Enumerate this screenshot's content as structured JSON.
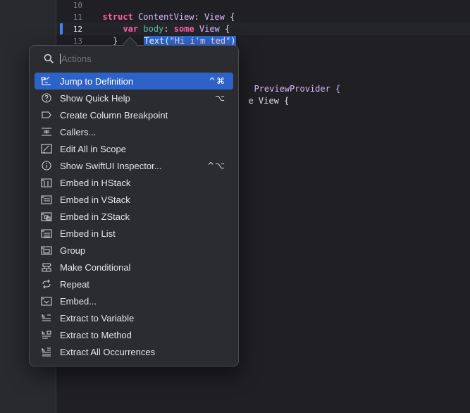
{
  "editor": {
    "lines": [
      {
        "num": "10",
        "text": "struct ContentView: View {"
      },
      {
        "num": "11",
        "text": "var body: some View {"
      },
      {
        "num": "12",
        "text": "Text(\"Hi i'm ted\")"
      },
      {
        "num": "13",
        "text": "}"
      }
    ],
    "partial_line_1": "PreviewProvider {",
    "partial_line_2": "e View {"
  },
  "popover": {
    "search_placeholder": "Actions",
    "items": [
      {
        "label": "Jump to Definition",
        "shortcut": "^⌘",
        "icon": "jump-icon",
        "selected": true
      },
      {
        "label": "Show Quick Help",
        "shortcut": "⌥",
        "icon": "question-icon"
      },
      {
        "label": "Create Column Breakpoint",
        "shortcut": "",
        "icon": "breakpoint-icon"
      },
      {
        "label": "Callers...",
        "shortcut": "",
        "icon": "callers-icon"
      },
      {
        "label": "Edit All in Scope",
        "shortcut": "",
        "icon": "edit-scope-icon"
      },
      {
        "label": "Show SwiftUI Inspector...",
        "shortcut": "^⌥",
        "icon": "info-icon"
      },
      {
        "label": "Embed in HStack",
        "shortcut": "",
        "icon": "hstack-icon"
      },
      {
        "label": "Embed in VStack",
        "shortcut": "",
        "icon": "vstack-icon"
      },
      {
        "label": "Embed in ZStack",
        "shortcut": "",
        "icon": "zstack-icon"
      },
      {
        "label": "Embed in List",
        "shortcut": "",
        "icon": "list-icon"
      },
      {
        "label": "Group",
        "shortcut": "",
        "icon": "group-icon"
      },
      {
        "label": "Make Conditional",
        "shortcut": "",
        "icon": "conditional-icon"
      },
      {
        "label": "Repeat",
        "shortcut": "",
        "icon": "repeat-icon"
      },
      {
        "label": "Embed...",
        "shortcut": "",
        "icon": "embed-icon"
      },
      {
        "label": "Extract to Variable",
        "shortcut": "",
        "icon": "extract-variable-icon"
      },
      {
        "label": "Extract to Method",
        "shortcut": "",
        "icon": "extract-method-icon"
      },
      {
        "label": "Extract All Occurrences",
        "shortcut": "",
        "icon": "extract-all-icon"
      }
    ]
  },
  "colors": {
    "selection": "#2d63c8",
    "keyword": "#fc5fa3",
    "type": "#dabaff",
    "string": "#fc6a5d"
  }
}
